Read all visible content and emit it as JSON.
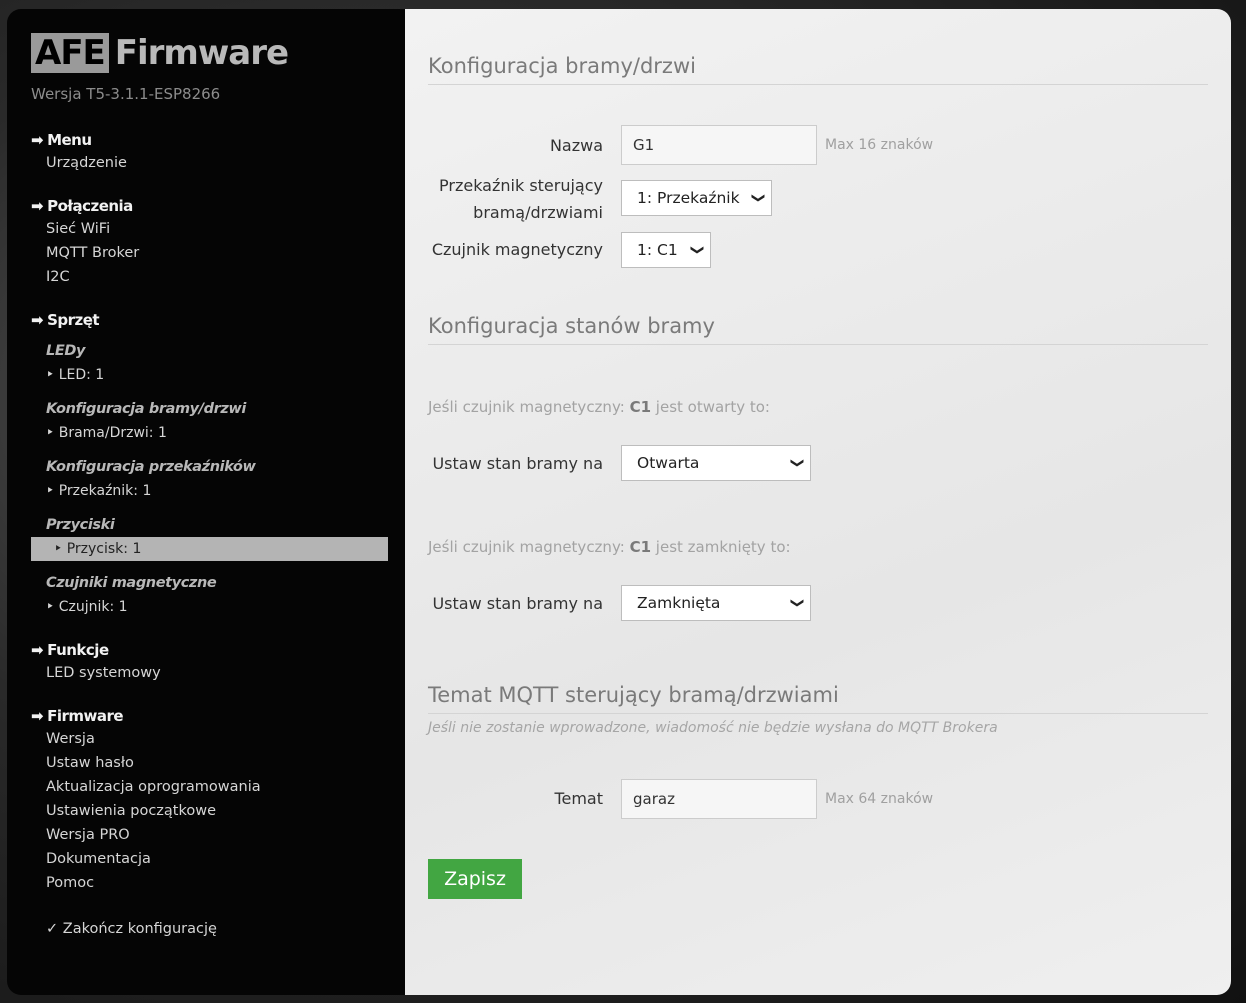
{
  "brand": {
    "logo_box": "AFE",
    "logo_text": "Firmware",
    "version": "Wersja T5-3.1.1-ESP8266"
  },
  "nav": {
    "menu": {
      "title": "Menu",
      "items": [
        "Urządzenie"
      ]
    },
    "polaczenia": {
      "title": "Połączenia",
      "items": [
        "Sieć WiFi",
        "MQTT Broker",
        "I2C"
      ]
    },
    "sprzet": {
      "title": "Sprzęt",
      "groups": [
        {
          "title": "LEDy",
          "item": "‣ LED: 1"
        },
        {
          "title": "Konfiguracja bramy/drzwi",
          "item": "‣ Brama/Drzwi: 1"
        },
        {
          "title": "Konfiguracja przekaźników",
          "item": "‣ Przekaźnik: 1"
        },
        {
          "title": "Przyciski",
          "item": "‣ Przycisk: 1"
        },
        {
          "title": "Czujniki magnetyczne",
          "item": "‣ Czujnik: 1"
        }
      ]
    },
    "funkcje": {
      "title": "Funkcje",
      "items": [
        "LED systemowy"
      ]
    },
    "firmware": {
      "title": "Firmware",
      "items": [
        "Wersja",
        "Ustaw hasło",
        "Aktualizacja oprogramowania",
        "Ustawienia początkowe",
        "Wersja PRO",
        "Dokumentacja",
        "Pomoc"
      ]
    },
    "finish": "✓ Zakończ konfigurację"
  },
  "gate": {
    "title": "Konfiguracja bramy/drzwi",
    "name_label": "Nazwa",
    "name_value": "G1",
    "name_hint": "Max 16 znaków",
    "relay_label_1": "Przekaźnik sterujący",
    "relay_label_2": "bramą/drzwiami",
    "relay_value": "1: Przekaźnik",
    "sensor_label": "Czujnik magnetyczny",
    "sensor_value": "1: C1"
  },
  "states": {
    "title": "Konfiguracja stanów bramy",
    "open_cond_prefix": "Jeśli czujnik magnetyczny:",
    "open_cond_sensor": "C1",
    "open_cond_suffix": "jest otwarty to:",
    "open_label": "Ustaw stan bramy na",
    "open_value": "Otwarta",
    "closed_cond_prefix": "Jeśli czujnik magnetyczny:",
    "closed_cond_sensor": "C1",
    "closed_cond_suffix": "jest zamknięty to:",
    "closed_label": "Ustaw stan bramy na",
    "closed_value": "Zamknięta"
  },
  "mqtt": {
    "title": "Temat MQTT sterujący bramą/drzwiami",
    "note": "Jeśli nie zostanie wprowadzone, wiadomość nie będzie wysłana do MQTT Brokera",
    "topic_label": "Temat",
    "topic_value": "garaz",
    "topic_hint": "Max 64 znaków"
  },
  "save_label": "Zapisz",
  "icons": {
    "section_arrow": "arrow-right-icon",
    "dropdown": "chevron-down-icon"
  }
}
